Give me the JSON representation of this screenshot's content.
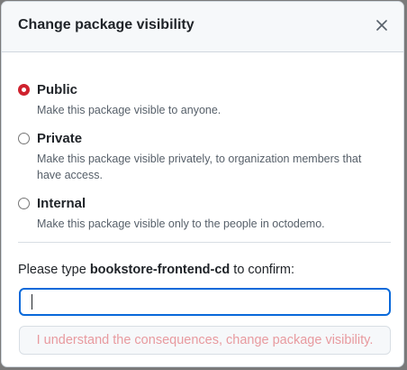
{
  "dialog": {
    "title": "Change package visibility",
    "close_icon": "close-icon"
  },
  "options": [
    {
      "label": "Public",
      "description": "Make this package visible to anyone.",
      "checked": true
    },
    {
      "label": "Private",
      "description": "Make this package visible privately, to organization members that have access.",
      "checked": false
    },
    {
      "label": "Internal",
      "description": "Make this package visible only to the people in octodemo.",
      "checked": false
    }
  ],
  "confirm": {
    "prefix": "Please type ",
    "package_name": "bookstore-frontend-cd",
    "suffix": " to confirm:",
    "input_value": ""
  },
  "submit": {
    "label": "I understand the consequences, change package visibility."
  },
  "colors": {
    "selected_radio": "#cf222e",
    "focus_border": "#0969da",
    "danger_text_disabled": "#e89a9f"
  }
}
